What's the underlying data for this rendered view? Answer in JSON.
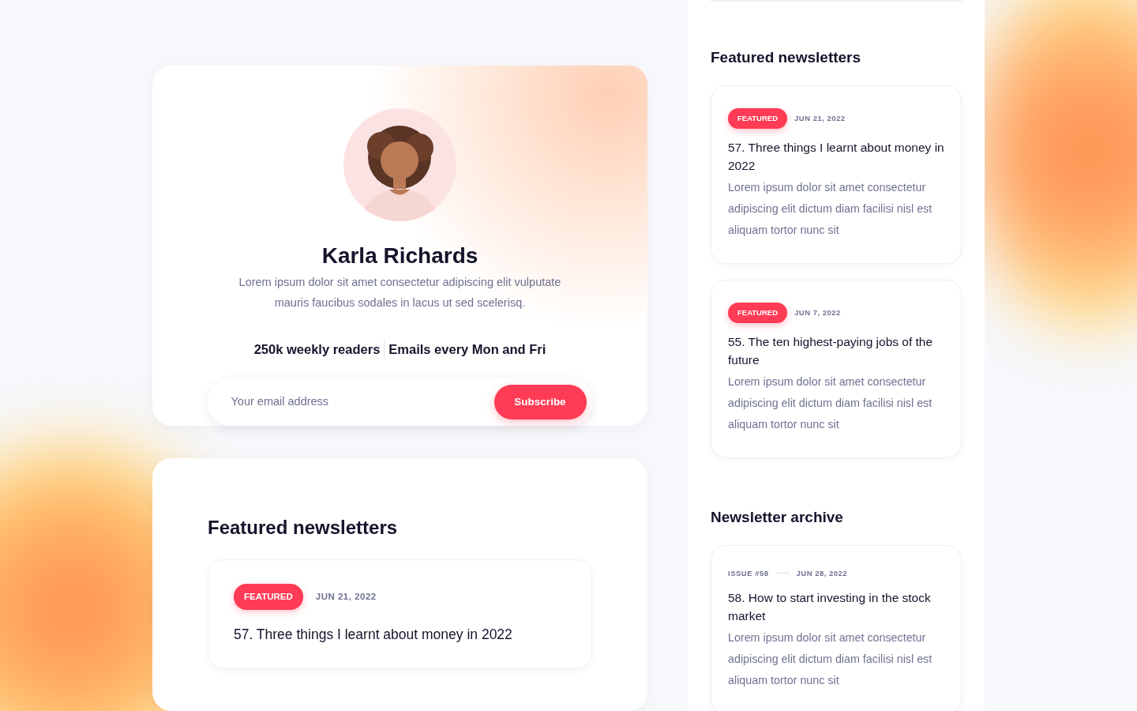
{
  "profile": {
    "name": "Karla Richards",
    "bio": "Lorem ipsum dolor sit amet consectetur adipiscing elit vulputate mauris faucibus sodales in lacus ut sed scelerisq.",
    "stats": [
      "250k weekly readers",
      "Emails every Mon and Fri"
    ],
    "email_placeholder": "Your email address",
    "subscribe_button": "Subscribe"
  },
  "featured_section": {
    "title": "Featured newsletters",
    "posts": [
      {
        "kind": "featured",
        "badge": "FEATURED",
        "date": "JUN 21, 2022",
        "title": "57. Three things I learnt about money in 2022"
      }
    ]
  },
  "sidebar": {
    "sections": [
      {
        "title": "Featured newsletters",
        "posts": [
          {
            "kind": "featured",
            "badge": "FEATURED",
            "date": "JUN 21, 2022",
            "title": "57. Three things I learnt about money in 2022",
            "excerpt": "Lorem ipsum dolor sit amet consectetur adipiscing elit dictum diam facilisi nisl est aliquam tortor nunc sit"
          },
          {
            "kind": "featured",
            "badge": "FEATURED",
            "date": "JUN 7, 2022",
            "title": "55. The ten highest-paying jobs of the future",
            "excerpt": "Lorem ipsum dolor sit amet consectetur adipiscing elit dictum diam facilisi nisl est aliquam tortor nunc sit"
          }
        ]
      },
      {
        "title": "Newsletter archive",
        "posts": [
          {
            "kind": "archive",
            "issue": "ISSUE #58",
            "date": "JUN 28, 2022",
            "title": "58. How to start investing in the stock market",
            "excerpt": "Lorem ipsum dolor sit amet consectetur adipiscing elit dictum diam facilisi nisl est aliquam tortor nunc sit"
          }
        ]
      }
    ]
  }
}
